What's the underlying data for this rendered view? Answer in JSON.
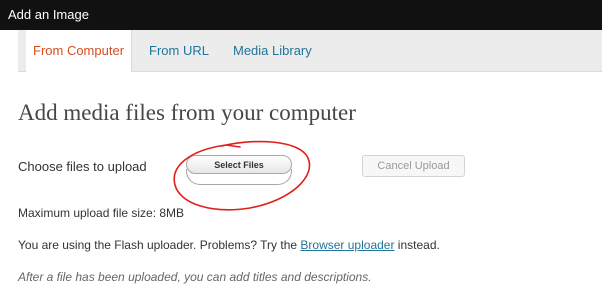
{
  "window": {
    "title": "Add an Image"
  },
  "tabs": [
    {
      "label": "From Computer",
      "active": true
    },
    {
      "label": "From URL",
      "active": false
    },
    {
      "label": "Media Library",
      "active": false
    }
  ],
  "main": {
    "heading": "Add media files from your computer",
    "choose_label": "Choose files to upload",
    "select_button": "Select Files",
    "cancel_button": "Cancel Upload",
    "max_size": "Maximum upload file size: 8MB",
    "flash_prefix": "You are using the Flash uploader. Problems? Try the ",
    "browser_link": "Browser uploader",
    "flash_suffix": " instead.",
    "after_text": "After a file has been uploaded, you can add titles and descriptions."
  },
  "colors": {
    "active_tab": "#d54e21",
    "link": "#21759b",
    "annotation": "#e0201c",
    "titlebar": "#111111"
  }
}
